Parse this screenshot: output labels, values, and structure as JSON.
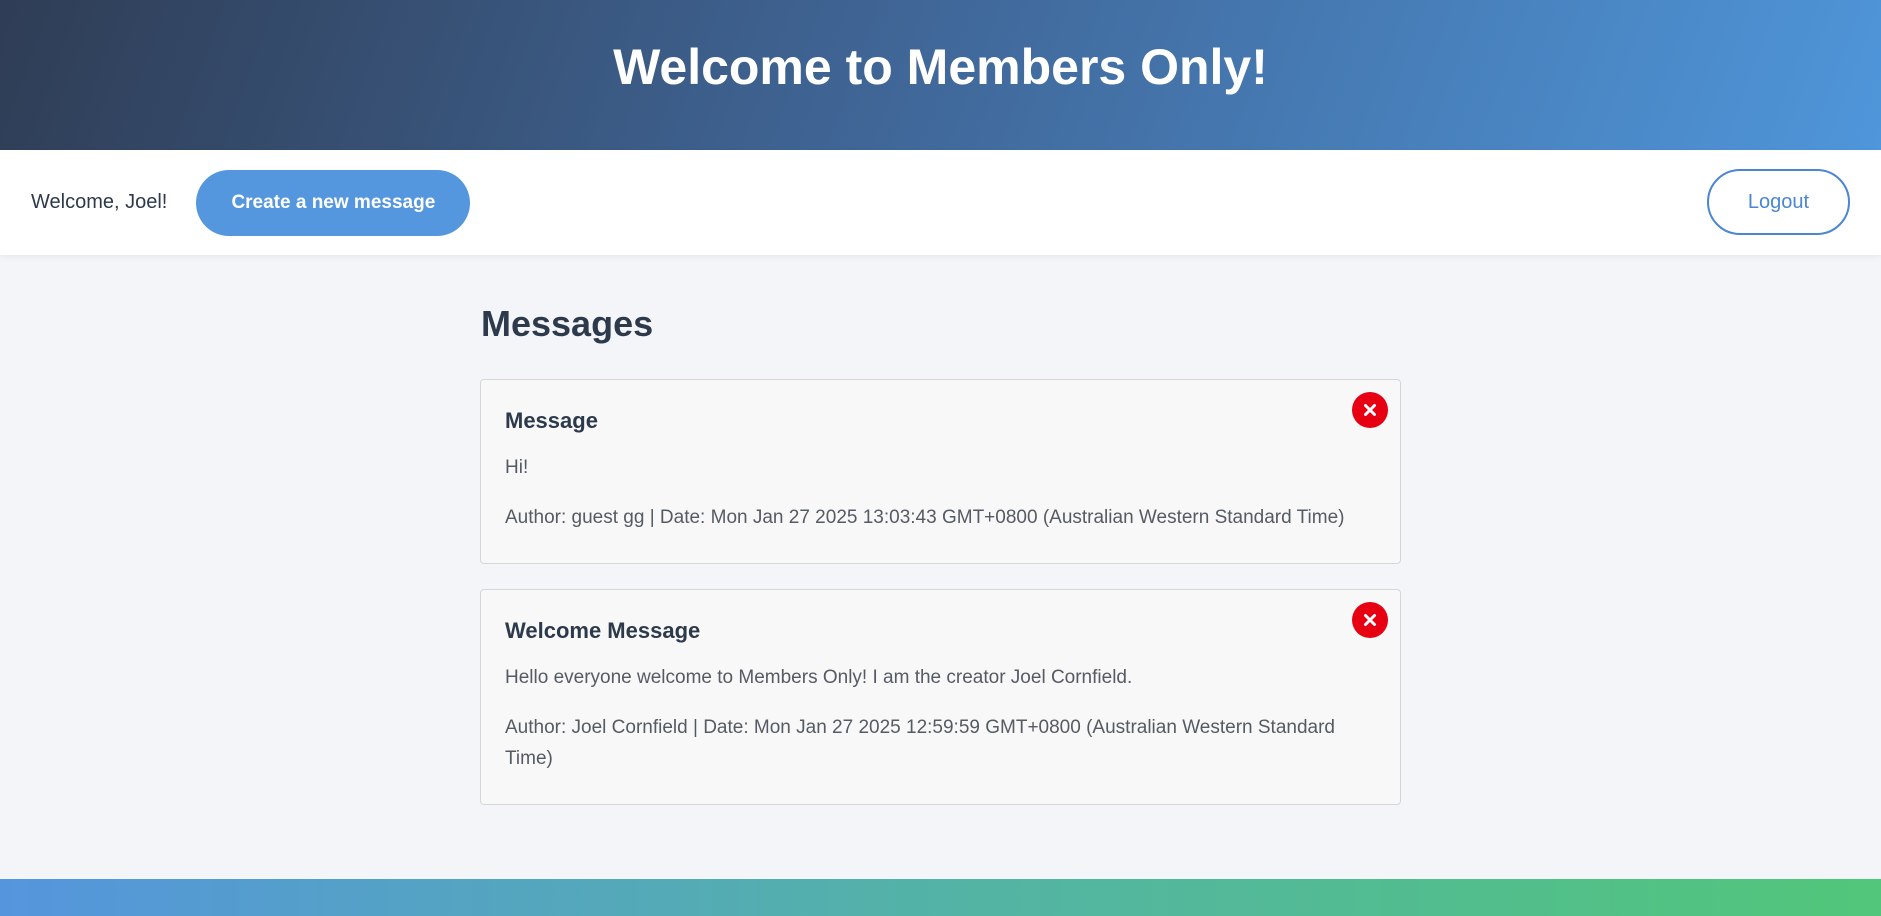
{
  "header": {
    "title": "Welcome to Members Only!"
  },
  "navbar": {
    "welcome_text": "Welcome, Joel!",
    "create_label": "Create a new message",
    "logout_label": "Logout"
  },
  "main": {
    "heading": "Messages",
    "messages": [
      {
        "title": "Message",
        "body": "Hi!",
        "meta": "Author: guest gg | Date: Mon Jan 27 2025 13:03:43 GMT+0800 (Australian Western Standard Time)"
      },
      {
        "title": "Welcome Message",
        "body": "Hello everyone welcome to Members Only! I am the creator Joel Cornfield.",
        "meta": "Author: Joel Cornfield | Date: Mon Jan 27 2025 12:59:59 GMT+0800 (Australian Western Standard Time)"
      }
    ]
  },
  "icons": {
    "delete": "close-icon"
  },
  "colors": {
    "accent": "#5597de",
    "delete": "#e60012",
    "banner_start": "#2f3d55",
    "banner_end": "#4f96da",
    "footer_start": "#5595dd",
    "footer_end": "#52c67a"
  }
}
